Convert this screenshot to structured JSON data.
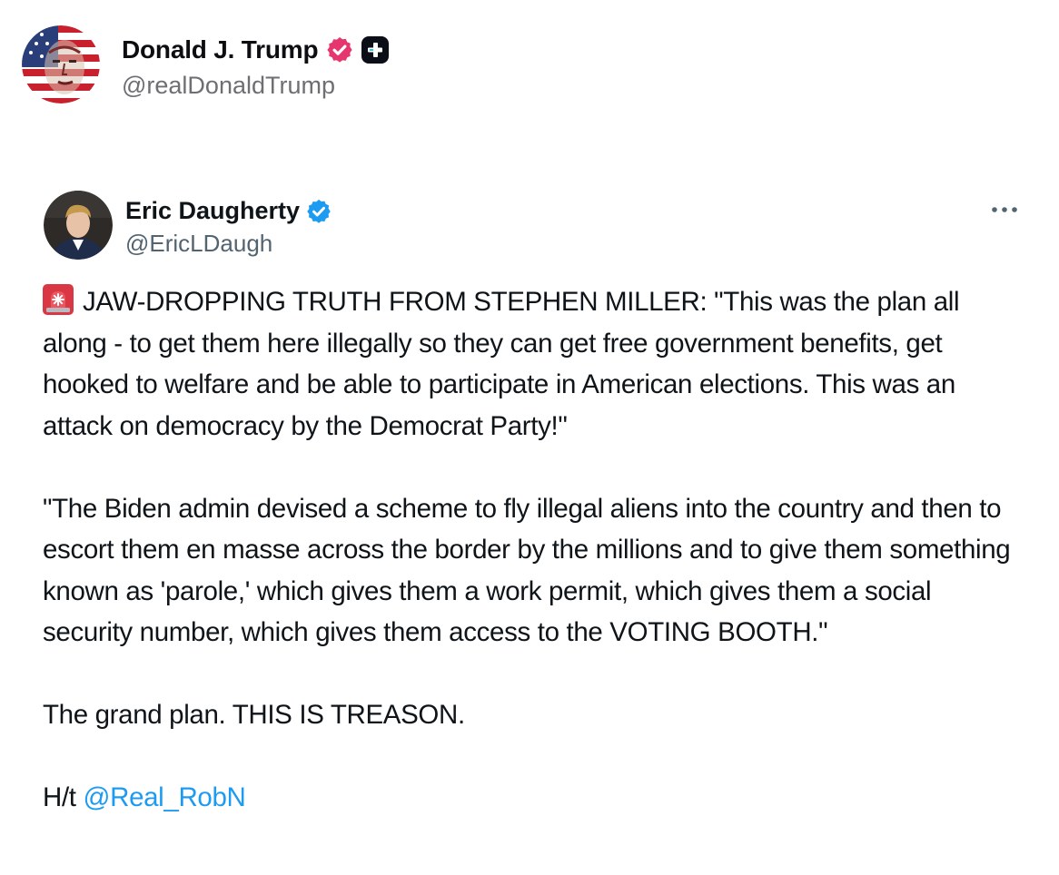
{
  "outer_post": {
    "display_name": "Donald J. Trump",
    "handle": "@realDonaldTrump",
    "verified_badge": "verified-badge-red",
    "extra_badge": "plus-badge",
    "avatar": "flag-portrait-avatar",
    "colors": {
      "verified": "#e0245e",
      "handle": "#6e6e73"
    }
  },
  "tweet": {
    "author_name": "Eric Daugherty",
    "author_handle": "@EricLDaugh",
    "verified_badge": "verified-badge-blue",
    "more_icon": "more-horizontal-icon",
    "paragraphs": [
      {
        "icon": "siren-icon",
        "text": "JAW-DROPPING TRUTH FROM STEPHEN MILLER: \"This was the plan all along - to get them here illegally so they can get free government benefits, get hooked to welfare and be able to participate in American elections. This was an attack on democracy by the Democrat Party!\""
      },
      {
        "text": "\"The Biden admin devised a scheme to fly illegal aliens into the country and then to escort them en masse across the border by the millions and to give them something known as 'parole,' which gives them a work permit, which gives them a social security number, which gives them access to the VOTING BOOTH.\""
      },
      {
        "text": "The grand plan. THIS IS TREASON."
      }
    ],
    "hat_tip": {
      "prefix": "H/t",
      "mention": "@Real_RobN"
    },
    "colors": {
      "link": "#1d9bf0",
      "verified": "#1d9bf0",
      "handle": "#536471"
    }
  }
}
